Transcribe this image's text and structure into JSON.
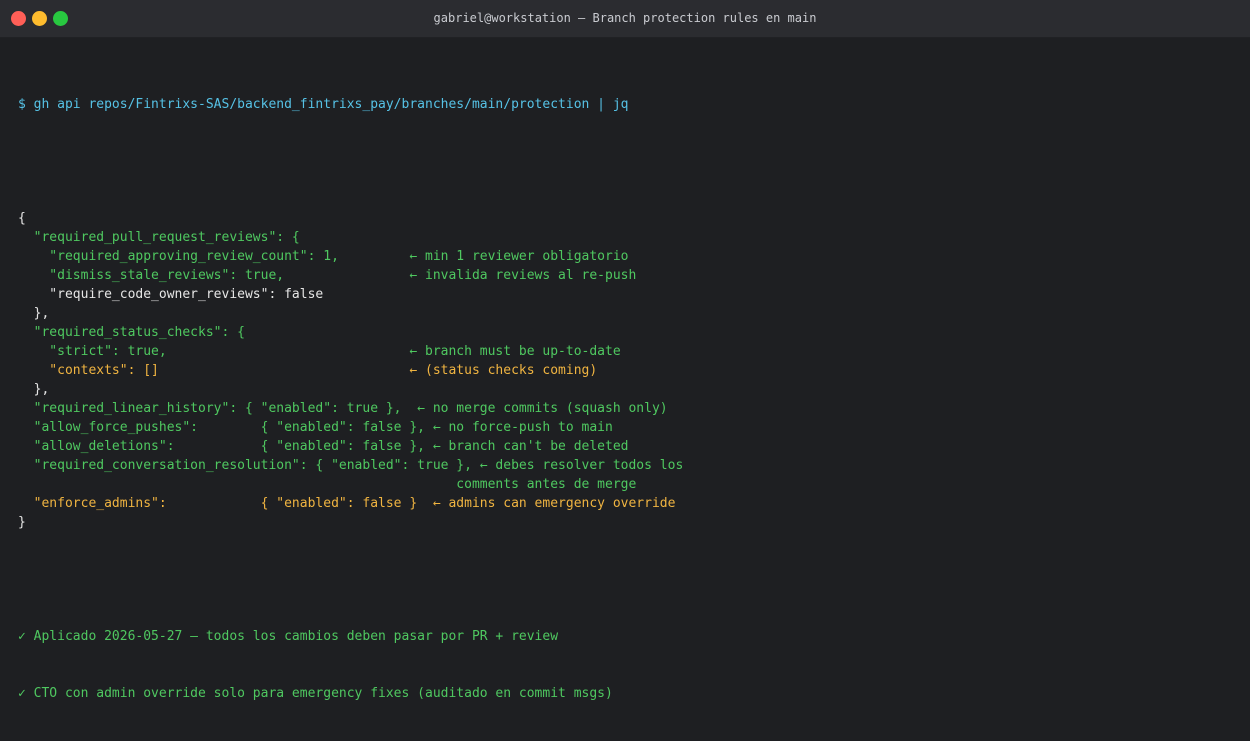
{
  "window": {
    "title": "gabriel@workstation — Branch protection rules en main",
    "buttons": {
      "close": "#ff5f57",
      "minimize": "#febc2e",
      "maximize": "#28c840"
    }
  },
  "colors": {
    "background": "#1e1f22",
    "prompt": "#56c2e6",
    "green": "#4fc860",
    "white": "#e6e6e6",
    "yellow": "#f0b441"
  },
  "terminal": {
    "command": "$ gh api repos/Fintrixs-SAS/backend_fintrixs_pay/branches/main/protection | jq",
    "lines": [
      {
        "text": "{",
        "color": "white"
      },
      {
        "text": "  \"required_pull_request_reviews\": {",
        "color": "green"
      },
      {
        "text": "    \"required_approving_review_count\": 1,         ← min 1 reviewer obligatorio",
        "color": "green"
      },
      {
        "text": "    \"dismiss_stale_reviews\": true,                ← invalida reviews al re-push",
        "color": "green"
      },
      {
        "text": "    \"require_code_owner_reviews\": false",
        "color": "white"
      },
      {
        "text": "  },",
        "color": "white"
      },
      {
        "text": "  \"required_status_checks\": {",
        "color": "green"
      },
      {
        "text": "    \"strict\": true,                               ← branch must be up-to-date",
        "color": "green"
      },
      {
        "text": "    \"contexts\": []                                ← (status checks coming)",
        "color": "yellow"
      },
      {
        "text": "  },",
        "color": "white"
      },
      {
        "text": "  \"required_linear_history\": { \"enabled\": true },  ← no merge commits (squash only)",
        "color": "green"
      },
      {
        "text": "  \"allow_force_pushes\":        { \"enabled\": false }, ← no force-push to main",
        "color": "green"
      },
      {
        "text": "  \"allow_deletions\":           { \"enabled\": false }, ← branch can't be deleted",
        "color": "green"
      },
      {
        "text": "  \"required_conversation_resolution\": { \"enabled\": true }, ← debes resolver todos los",
        "color": "green"
      },
      {
        "text": "                                                        comments antes de merge",
        "color": "green"
      },
      {
        "text": "  \"enforce_admins\":            { \"enabled\": false }  ← admins can emergency override",
        "color": "yellow"
      },
      {
        "text": "}",
        "color": "white"
      }
    ],
    "notes": [
      "✓ Aplicado 2026-05-27 — todos los cambios deben pasar por PR + review",
      "✓ CTO con admin override solo para emergency fixes (auditado en commit msgs)"
    ]
  }
}
